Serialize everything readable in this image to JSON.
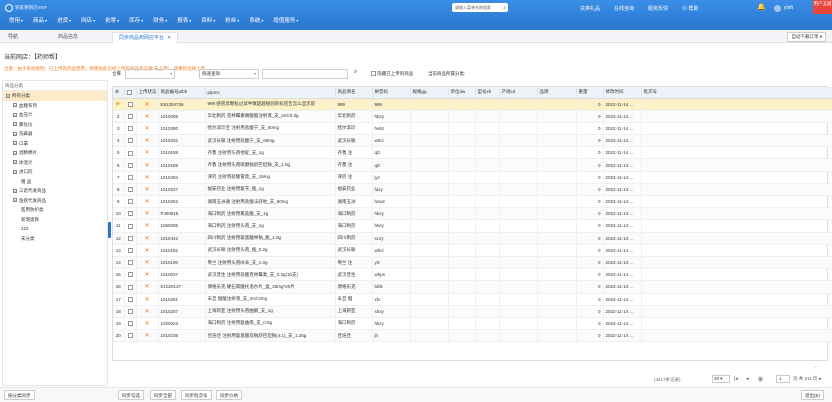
{
  "app": {
    "logo_text": "管家婆网店ERP",
    "menu": [
      {
        "label": "常用"
      },
      {
        "label": "商品"
      },
      {
        "label": "进货"
      },
      {
        "label": "网店"
      },
      {
        "label": "批零"
      },
      {
        "label": "库存"
      },
      {
        "label": "财务"
      },
      {
        "label": "报表"
      },
      {
        "label": "资料"
      },
      {
        "label": "粉丝"
      },
      {
        "label": "系统"
      },
      {
        "label": "增值服务"
      }
    ],
    "search_placeholder": "请输入菜单名称搜索",
    "top_links": [
      "兑换礼品",
      "在线咨询",
      "服务反馈",
      "帮助"
    ],
    "username": "yinh",
    "user_badge": "用户五级"
  },
  "tabs": {
    "nav": "导航",
    "product_info": "商品信息",
    "active": "同步商品到网店平台",
    "auto_download": "自动下载订单"
  },
  "header": {
    "shop_label": "当前网店：",
    "shop_name": "【药师帮】",
    "notice": "注意：由于系统限制，已上传的药品禁用，即使如此已经上传的商品状态更“未上传”，请重新选择上传。"
  },
  "left_panel": {
    "title": "商品分类",
    "items": [
      {
        "label": "所有分类",
        "type": "root"
      },
      {
        "label": "血糖系列",
        "type": "branch"
      },
      {
        "label": "血压计",
        "type": "branch"
      },
      {
        "label": "雾化仪",
        "type": "branch"
      },
      {
        "label": "洗鼻器",
        "type": "branch"
      },
      {
        "label": "口罩",
        "type": "branch"
      },
      {
        "label": "酒精棉片",
        "type": "branch"
      },
      {
        "label": "体温计",
        "type": "branch"
      },
      {
        "label": "进口药",
        "type": "branch"
      },
      {
        "label": "赠 品",
        "type": "leaf"
      },
      {
        "label": "三诺代发商品",
        "type": "branch"
      },
      {
        "label": "鱼跃代发商品",
        "type": "branch"
      },
      {
        "label": "医用防护类",
        "type": "leaf"
      },
      {
        "label": "新增类目",
        "type": "leaf"
      },
      {
        "label": "222",
        "type": "leaf"
      },
      {
        "label": "未分类",
        "type": "leaf"
      }
    ]
  },
  "filters": {
    "warehouse_label": "仓库",
    "warehouse_value": "",
    "query_value": "快速查询",
    "search_value": "",
    "hide_uploaded_label": "隐藏已上传的商品",
    "platform_category_label": "当前商品所属分类:"
  },
  "grid": {
    "columns": [
      "",
      "",
      "上传状态",
      "商品编号ptbh",
      "ptpmc",
      "商品简名",
      "拼音码",
      "规格gg",
      "单位dw",
      "型号xh",
      "产地cd",
      "品牌",
      "重量",
      "修改时间",
      "批次号"
    ],
    "rows": [
      [
        "▶",
        "",
        "✕",
        "E91254736",
        "999 感冒灵颗粒过试半数超越规则的标签告怎么显示前",
        "999",
        "999",
        "",
        "",
        "",
        "",
        "",
        "0",
        "2022-11-14 ...",
        ""
      ],
      [
        "2",
        "",
        "✕",
        "1010206",
        "华北制药 克林霉素磷酸酯注射液_支_2ml:0.3g",
        "华北制药",
        "hbzy",
        "",
        "",
        "",
        "",
        "",
        "0",
        "2022-11-14 ...",
        ""
      ],
      [
        "3",
        "",
        "✕",
        "1010280",
        "哈尔滨珍宝 注射用盐酸宁_支_60mg",
        "哈尔滨珍",
        "hebz",
        "",
        "",
        "",
        "",
        "",
        "0",
        "2022-11-14 ...",
        ""
      ],
      [
        "4",
        "",
        "✕",
        "1010332",
        "武汉长联 注射用盐酸宁_支_60mg",
        "武汉长联",
        "whcl",
        "",
        "",
        "",
        "",
        "",
        "0",
        "2022-11-14 ...",
        ""
      ],
      [
        "5",
        "",
        "✕",
        "1010188",
        "齐鲁 注射用头孢他啶_支_1g",
        "齐鲁 注",
        "qlz",
        "",
        "",
        "",
        "",
        "",
        "0",
        "2022-11-14 ...",
        ""
      ],
      [
        "6",
        "",
        "✕",
        "1010189",
        "齐鲁 注射用头孢哌酮钠舒巴坦钠_支_1.0g",
        "齐鲁 注",
        "qlz",
        "",
        "",
        "",
        "",
        "",
        "0",
        "2022-11-14 ...",
        ""
      ],
      [
        "7",
        "",
        "✕",
        "1010404",
        "津药 注射用盐酸雷莫_支_15mg",
        "津药 注",
        "jyz",
        "",
        "",
        "",
        "",
        "",
        "0",
        "2022-11-14 ...",
        ""
      ],
      [
        "8",
        "",
        "✕",
        "1010227",
        "福安药业 注射用氨苄_瓶_1g",
        "福安药业",
        "fazy",
        "",
        "",
        "",
        "",
        "",
        "0",
        "2022-11-14 ...",
        ""
      ],
      [
        "9",
        "",
        "✕",
        "1010262",
        "湖南五洲通 注射用盐酸法舒地_支_60mg",
        "湖南五洲",
        "hnwz",
        "",
        "",
        "",
        "",
        "",
        "0",
        "2022-11-14 ...",
        ""
      ],
      [
        "10",
        "",
        "✕",
        "PJ00915",
        "海口制药 注射用氯盐酸_支_1g",
        "海口制药",
        "hkzy",
        "",
        "",
        "",
        "",
        "",
        "0",
        "2022-11-14 ...",
        ""
      ],
      [
        "11",
        "",
        "✕",
        "1060006",
        "海口制药 注射用头孢_支_1g",
        "海口制药",
        "hkzy",
        "",
        "",
        "",
        "",
        "",
        "0",
        "2022-11-14 ...",
        ""
      ],
      [
        "12",
        "",
        "✕",
        "1010442",
        "四川制药 注射用氨基酸林钠_瓶_1.0g",
        "四川制药",
        "sczy",
        "",
        "",
        "",
        "",
        "",
        "0",
        "2022-11-14 ...",
        ""
      ],
      [
        "13",
        "",
        "✕",
        "1010182",
        "武汉长联 注射用头孢_瓶_0.2g",
        "武汉长联",
        "whcl",
        "",
        "",
        "",
        "",
        "",
        "0",
        "2022-11-14 ...",
        ""
      ],
      [
        "14",
        "",
        "✕",
        "1010190",
        "粤兰 注射用头孢呋辛_支_1.0g",
        "粤兰 注",
        "ylz",
        "",
        "",
        "",
        "",
        "",
        "0",
        "2022-11-14 ...",
        ""
      ],
      [
        "15",
        "",
        "✕",
        "1010037",
        "武汉普生 注射用盐酸克林霉素_支_0.3g(10支)",
        "武汉普生",
        "whps",
        "",
        "",
        "",
        "",
        "",
        "0",
        "2022-11-14 ...",
        ""
      ],
      [
        "16",
        "",
        "✕",
        "K1020137",
        "博格乐克 硬石膏酸托洛尔片_盒_25mg*20片",
        "博格乐克",
        "bblk",
        "",
        "",
        "",
        "",
        "",
        "0",
        "2022-11-14 ...",
        ""
      ],
      [
        "17",
        "",
        "✕",
        "1010281",
        "辛旦 烟酸注射液_支_2ml:0mg",
        "辛旦 烟",
        "xfx",
        "",
        "",
        "",
        "",
        "",
        "0",
        "2022-11-14 ...",
        ""
      ],
      [
        "18",
        "",
        "✕",
        "1010207",
        "上海新亚 注射用头孢曲酮_支_1g",
        "上海新亚",
        "shxy",
        "",
        "",
        "",
        "",
        "",
        "0",
        "2022-11-14 ...",
        ""
      ],
      [
        "19",
        "",
        "✕",
        "1020023",
        "海口制药 注射用氨曲南_支_0.5g",
        "海口制药",
        "hkzy",
        "",
        "",
        "",
        "",
        "",
        "0",
        "2022-11-14 ...",
        ""
      ],
      [
        "20",
        "",
        "✕",
        "1010236",
        "佳浩佳 注射用氨基酸双钠舒巴坦钠(4:1)_支_1.25g",
        "佳浩佳",
        "jh",
        "",
        "",
        "",
        "",
        "",
        "0",
        "2022-11-14 ...",
        ""
      ]
    ]
  },
  "pager": {
    "total": "(4217条记录)",
    "page_size": "20",
    "current_page": "1",
    "total_pages_label": "页 共 211 页"
  },
  "bottom_buttons": {
    "sync_all_shop": "按分类同步",
    "sync_selected": "同步勾选",
    "sync_all": "同步全部",
    "batch_sync": "同步批次号",
    "sync_price": "同步价格",
    "exit": "退出(E)"
  }
}
